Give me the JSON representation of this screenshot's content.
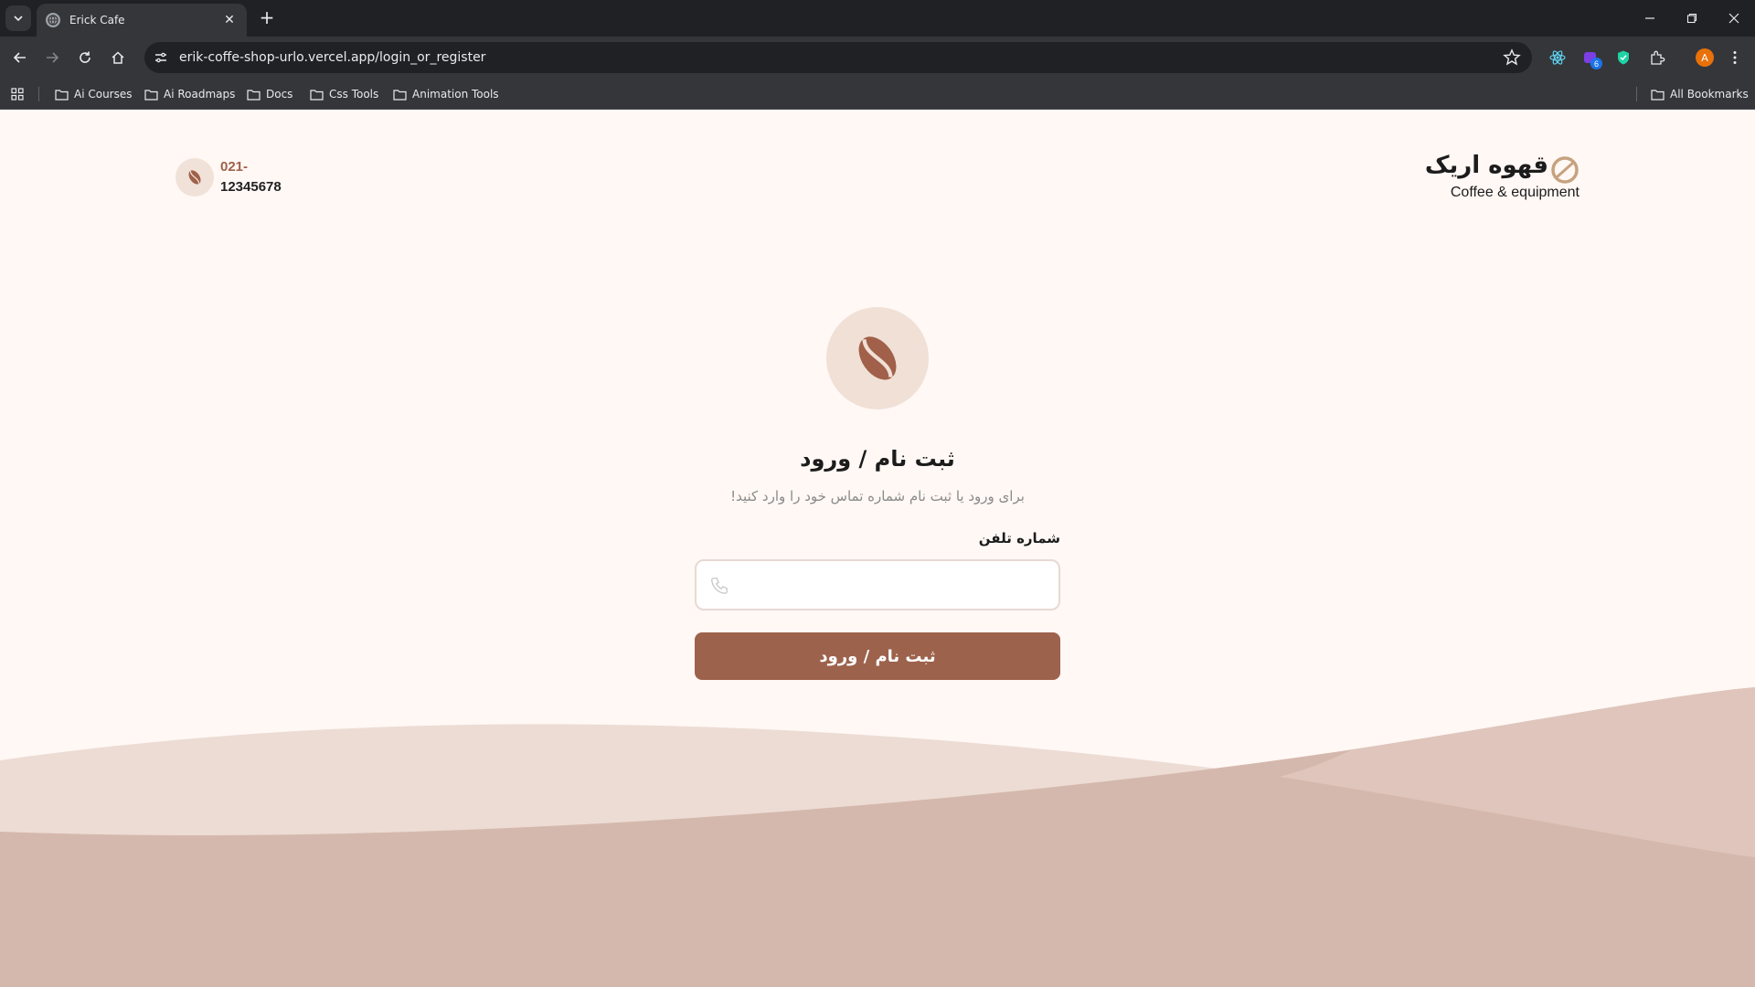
{
  "browser": {
    "tab_title": "Erick Cafe",
    "url": "erik-coffe-shop-urlo.vercel.app/login_or_register",
    "extension_badge": "6",
    "profile_initial": "A",
    "bookmarks": [
      "Ai Courses",
      "Ai Roadmaps",
      "Docs",
      "Css Tools",
      "Animation Tools"
    ],
    "all_bookmarks_label": "All Bookmarks"
  },
  "header": {
    "phone_prefix": "021-",
    "phone_number": "12345678",
    "logo_fa": "قهوه اریک",
    "logo_en": "Coffee & equipment"
  },
  "auth": {
    "title": "ثبت نام / ورود",
    "subtitle": "برای ورود یا ثبت نام شماره تماس خود را وارد کنید!",
    "phone_label": "شماره تلفن",
    "phone_value": "",
    "submit_label": "ثبت نام / ورود"
  },
  "colors": {
    "page_bg": "#fff8f5",
    "accent": "#9d624c",
    "wave_light": "#ecdcd4",
    "wave_dark": "#d5b8ad"
  }
}
